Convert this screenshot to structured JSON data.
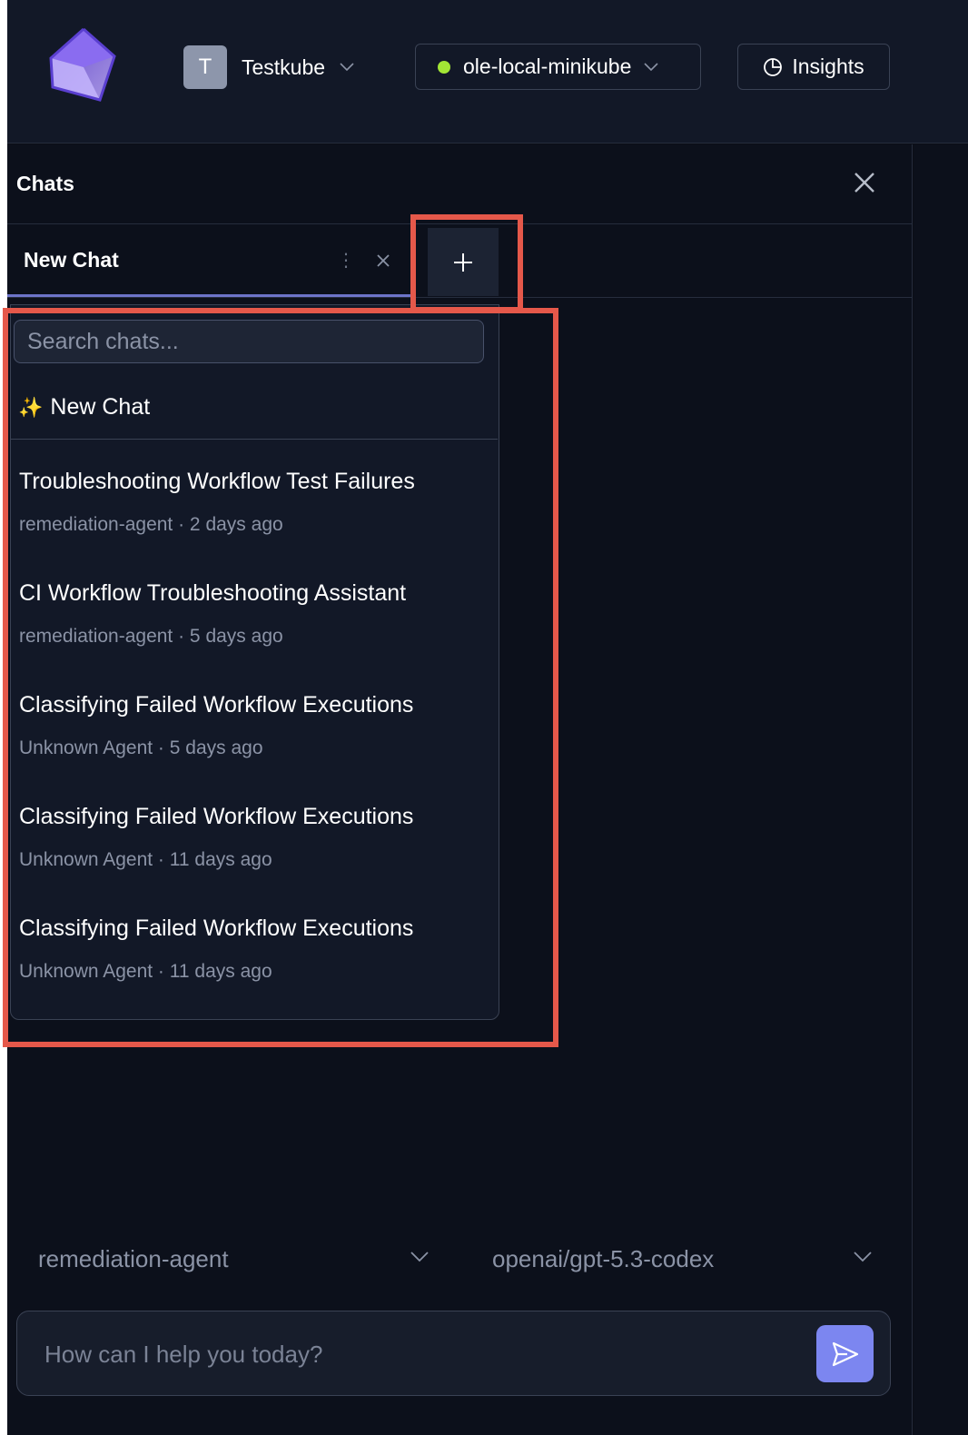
{
  "topbar": {
    "org": {
      "initial": "T",
      "name": "Testkube"
    },
    "environment": {
      "name": "ole-local-minikube",
      "status_color": "#a3e635"
    },
    "insights_label": "Insights"
  },
  "panel": {
    "title": "Chats",
    "tab": {
      "label": "New Chat",
      "menu_glyph": "⋮"
    }
  },
  "dropdown": {
    "search_placeholder": "Search chats...",
    "new_chat_label": "New Chat",
    "new_chat_icon": "✨",
    "items": [
      {
        "title": "Troubleshooting Workflow Test Failures",
        "meta": "remediation-agent · 2 days ago"
      },
      {
        "title": "CI Workflow Troubleshooting Assistant",
        "meta": "remediation-agent · 5 days ago"
      },
      {
        "title": "Classifying Failed Workflow Executions",
        "meta": "Unknown Agent · 5 days ago"
      },
      {
        "title": "Classifying Failed Workflow Executions",
        "meta": "Unknown Agent · 11 days ago"
      },
      {
        "title": "Classifying Failed Workflow Executions",
        "meta": "Unknown Agent · 11 days ago"
      }
    ]
  },
  "composer": {
    "agent": "remediation-agent",
    "model": "openai/gpt-5.3-codex",
    "placeholder": "How can I help you today?"
  },
  "colors": {
    "accent": "#7c86f0",
    "highlight": "#e5584a",
    "background": "#0b0e17"
  }
}
